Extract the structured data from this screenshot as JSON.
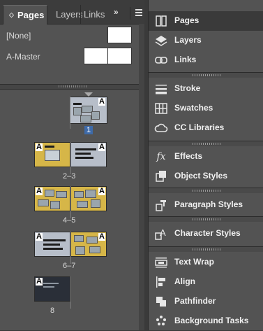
{
  "tabs": {
    "pages": "Pages",
    "layers": "Layers",
    "links": "Links"
  },
  "overflow": "»",
  "masters": {
    "none": "[None]",
    "a_master": "A-Master"
  },
  "spread_labels": [
    "1",
    "2–3",
    "4–5",
    "6–7",
    "8"
  ],
  "page_prefix": "A",
  "dock": {
    "items": [
      "Pages",
      "Layers",
      "Links",
      "Stroke",
      "Swatches",
      "CC Libraries",
      "Effects",
      "Object Styles",
      "Paragraph Styles",
      "Character Styles",
      "Text Wrap",
      "Align",
      "Pathfinder",
      "Background Tasks"
    ]
  },
  "colors": {
    "selection": "#3e6aa8",
    "page_yellow": "#d6b648"
  }
}
